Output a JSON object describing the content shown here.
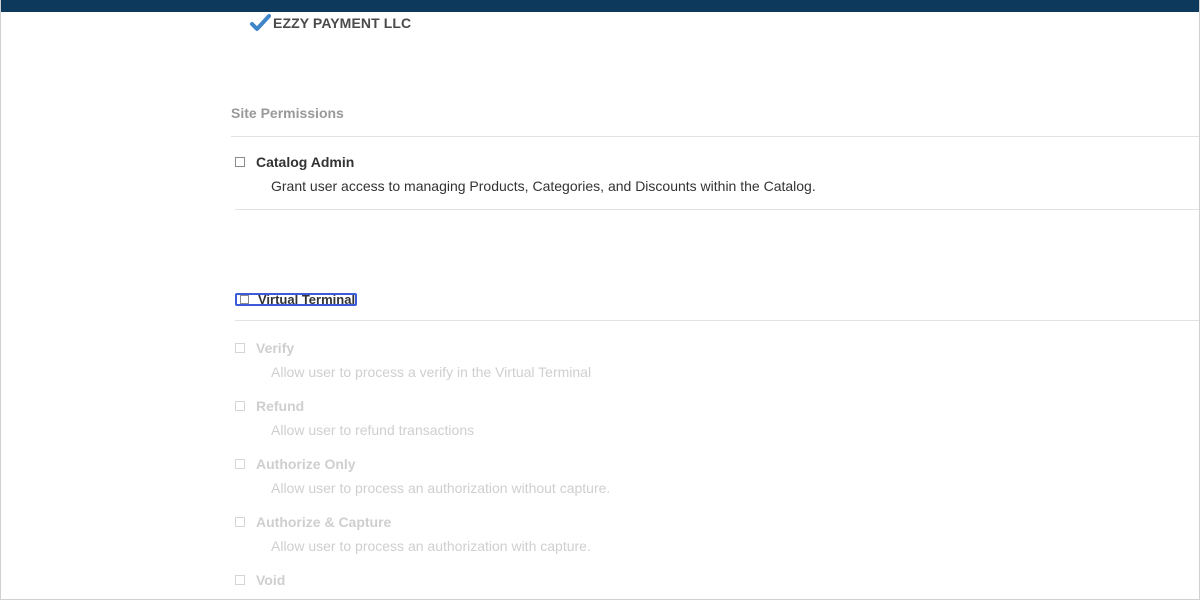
{
  "merchant": {
    "name": "EZZY PAYMENT LLC",
    "icon": "check-icon",
    "icon_color": "#3f86c8"
  },
  "site_permissions": {
    "title": "Site Permissions",
    "items": [
      {
        "label": "Catalog Admin",
        "description": "Grant user access to managing Products, Categories, and Discounts within the Catalog.",
        "checked": false,
        "disabled": false
      }
    ]
  },
  "virtual_terminal": {
    "label": "Virtual Terminal",
    "checked": false,
    "focused": true,
    "items": [
      {
        "label": "Verify",
        "description": "Allow user to process a verify in the Virtual Terminal",
        "checked": false,
        "disabled": true
      },
      {
        "label": "Refund",
        "description": "Allow user to refund transactions",
        "checked": false,
        "disabled": true
      },
      {
        "label": "Authorize Only",
        "description": "Allow user to process an authorization without capture.",
        "checked": false,
        "disabled": true
      },
      {
        "label": "Authorize & Capture",
        "description": "Allow user to process an authorization with capture.",
        "checked": false,
        "disabled": true
      },
      {
        "label": "Void",
        "checked": false,
        "disabled": true
      }
    ]
  },
  "colors": {
    "header_bar": "#0d3a5c",
    "focus_ring": "#3b5bdb",
    "disabled_text": "#cfcfcf"
  }
}
